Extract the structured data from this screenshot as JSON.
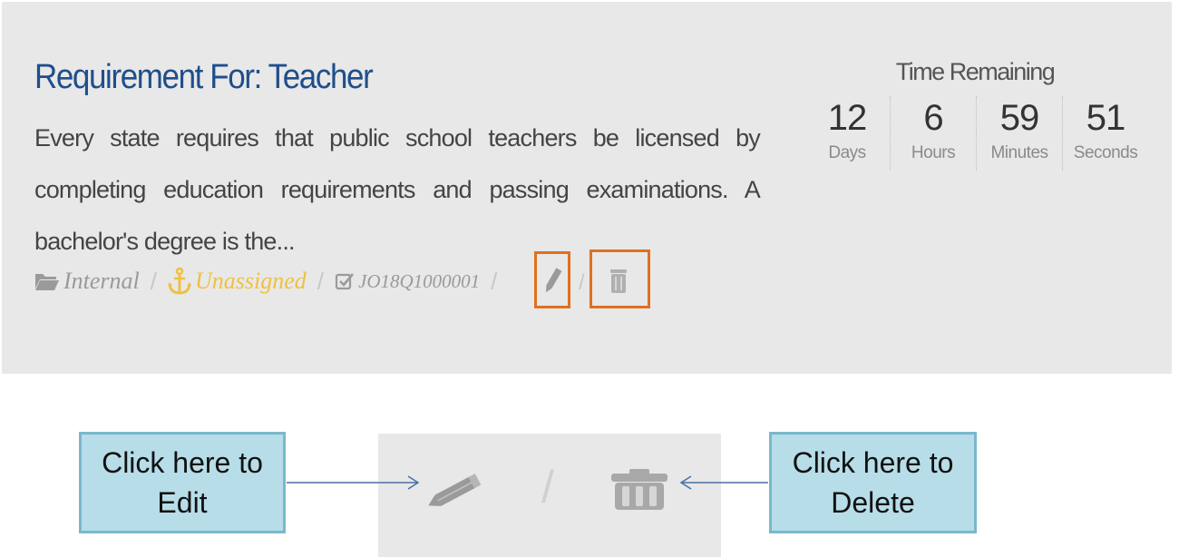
{
  "requirement": {
    "title": "Requirement For: Teacher",
    "description": "Every state requires that public school teachers be licensed by completing education requirements and passing examinations. A bachelor's degree is the...",
    "meta": {
      "type_label": "Internal",
      "type_icon": "folder-open-icon",
      "assignee_label": "Unassigned",
      "assignee_icon": "anchor-icon",
      "assignee_color": "#f0c040",
      "job_id": "JO18Q1000001",
      "job_id_icon": "check-square-icon",
      "separator": "/"
    }
  },
  "timer": {
    "title": "Time Remaining",
    "units": [
      {
        "value": "12",
        "label": "Days"
      },
      {
        "value": "6",
        "label": "Hours"
      },
      {
        "value": "59",
        "label": "Minutes"
      },
      {
        "value": "51",
        "label": "Seconds"
      }
    ]
  },
  "callouts": {
    "edit": "Click here to Edit",
    "delete": "Click here to Delete"
  },
  "zoom": {
    "separator": "/"
  },
  "colors": {
    "title": "#1f4e8c",
    "highlight_border": "#e07020",
    "callout_bg": "#b7dde8",
    "card_bg": "#e8e8e8"
  }
}
